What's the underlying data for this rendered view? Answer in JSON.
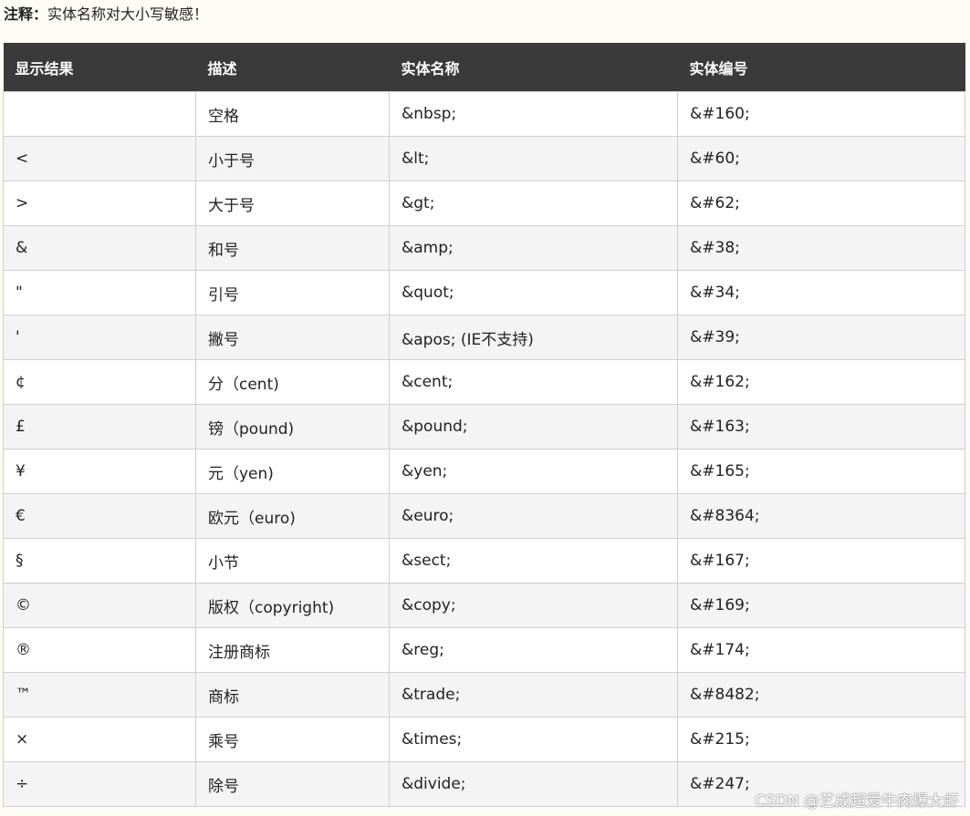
{
  "note": {
    "label": "注释：",
    "text": "实体名称对大小写敏感！"
  },
  "table": {
    "headers": [
      "显示结果",
      "描述",
      "实体名称",
      "实体编号"
    ],
    "rows": [
      [
        "",
        "空格",
        "&nbsp;",
        "&#160;"
      ],
      [
        "<",
        "小于号",
        "&lt;",
        "&#60;"
      ],
      [
        ">",
        "大于号",
        "&gt;",
        "&#62;"
      ],
      [
        "&",
        "和号",
        "&amp;",
        "&#38;"
      ],
      [
        "\"",
        "引号",
        "&quot;",
        "&#34;"
      ],
      [
        "'",
        "撇号",
        "&apos; (IE不支持)",
        "&#39;"
      ],
      [
        "¢",
        "分（cent)",
        "&cent;",
        "&#162;"
      ],
      [
        "£",
        "镑（pound)",
        "&pound;",
        "&#163;"
      ],
      [
        "¥",
        "元（yen)",
        "&yen;",
        "&#165;"
      ],
      [
        "€",
        "欧元（euro)",
        "&euro;",
        "&#8364;"
      ],
      [
        "§",
        "小节",
        "&sect;",
        "&#167;"
      ],
      [
        "©",
        "版权（copyright)",
        "&copy;",
        "&#169;"
      ],
      [
        "®",
        "注册商标",
        "&reg;",
        "&#174;"
      ],
      [
        "™",
        "商标",
        "&trade;",
        "&#8482;"
      ],
      [
        "×",
        "乘号",
        "&times;",
        "&#215;"
      ],
      [
        "÷",
        "除号",
        "&divide;",
        "&#247;"
      ]
    ]
  },
  "watermark": "CSDN @艺成超爱牛肉爆大虾"
}
